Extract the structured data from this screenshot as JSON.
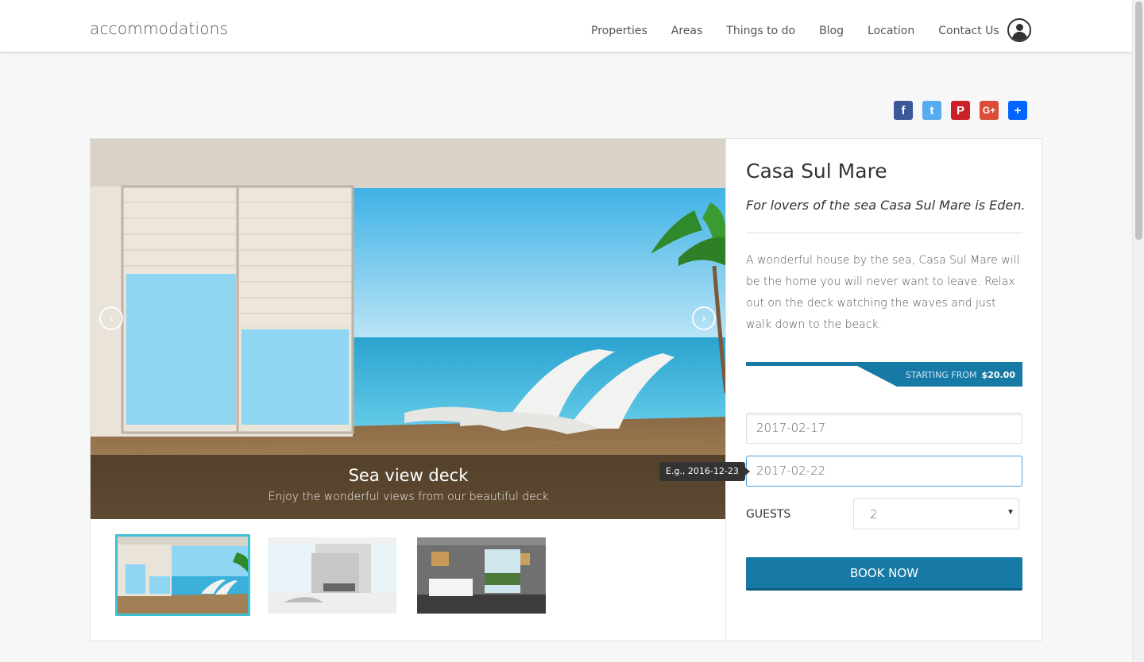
{
  "header": {
    "brand": "accommodations",
    "nav": [
      "Properties",
      "Areas",
      "Things to do",
      "Blog",
      "Location",
      "Contact Us"
    ]
  },
  "share": {
    "icons": [
      "facebook-icon",
      "twitter-icon",
      "pinterest-icon",
      "google-plus-icon",
      "share-plus-icon"
    ],
    "facebook_glyph": "f",
    "twitter_glyph": "t",
    "pinterest_glyph": "P",
    "googleplus_glyph": "G+",
    "add_glyph": "+"
  },
  "slider": {
    "caption_title": "Sea view deck",
    "caption_text": "Enjoy the wonderful views from our beautiful deck",
    "prev": "‹",
    "next": "›"
  },
  "property": {
    "title": "Casa Sul Mare",
    "tagline": "For lovers of the sea Casa Sul Mare is Eden.",
    "description": "A wonderful house by the sea, Casa Sul Mare will be the home you will never want to leave. Relax out on the deck watching the waves and just walk down to the beack.",
    "price_label": "STARTING FROM",
    "price": "$20.00"
  },
  "booking": {
    "checkin": "2017-02-17",
    "checkout": "2017-02-22",
    "tooltip": "E.g., 2016-12-23",
    "guests_label": "GUESTS",
    "guests_value": "2",
    "book_label": "BOOK NOW"
  },
  "colors": {
    "accent": "#177aa6",
    "thumb_active": "#3ec2d6"
  }
}
